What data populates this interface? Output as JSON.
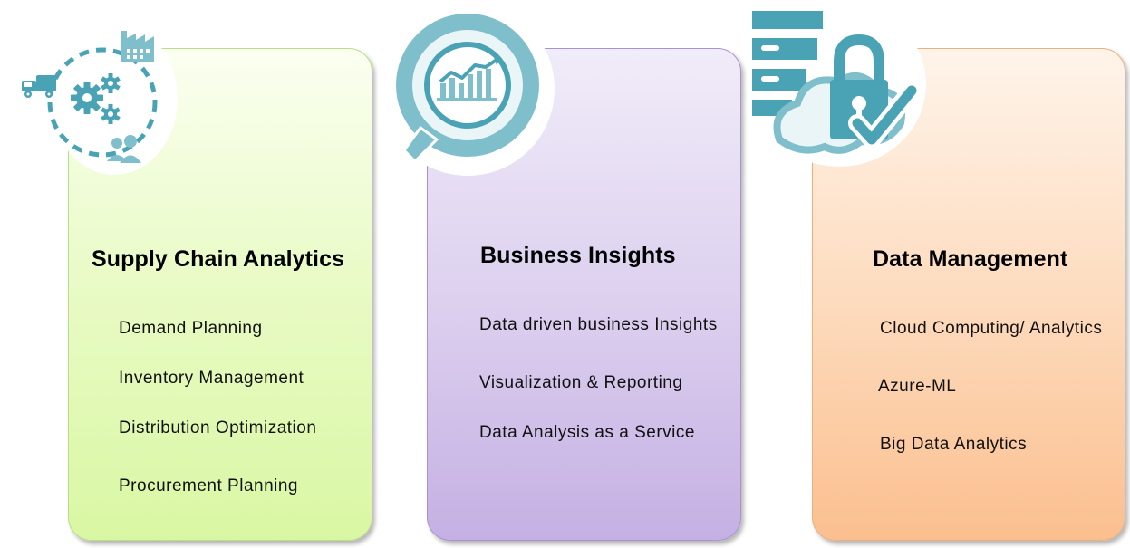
{
  "colors": {
    "icon_teal": "#4aa3b5",
    "icon_teal_light": "#7fbfcc",
    "card_green": "#e3f9b8",
    "card_purple": "#d3c3eb",
    "card_orange": "#fcd0aa"
  },
  "cards": [
    {
      "icon": "supply-chain-gears-truck-icon",
      "title": "Supply Chain Analytics",
      "items": [
        "Demand  Planning",
        "Inventory Management",
        "Distribution Optimization",
        "Procurement  Planning"
      ]
    },
    {
      "icon": "magnifier-chart-icon",
      "title": "Business Insights",
      "items": [
        "Data driven business Insights",
        "Visualization  & Reporting",
        "Data Analysis as a Service"
      ]
    },
    {
      "icon": "cloud-lock-check-icon",
      "title": "Data Management",
      "items": [
        "Cloud Computing/  Analytics",
        "Azure-ML",
        "Big Data Analytics"
      ]
    }
  ]
}
